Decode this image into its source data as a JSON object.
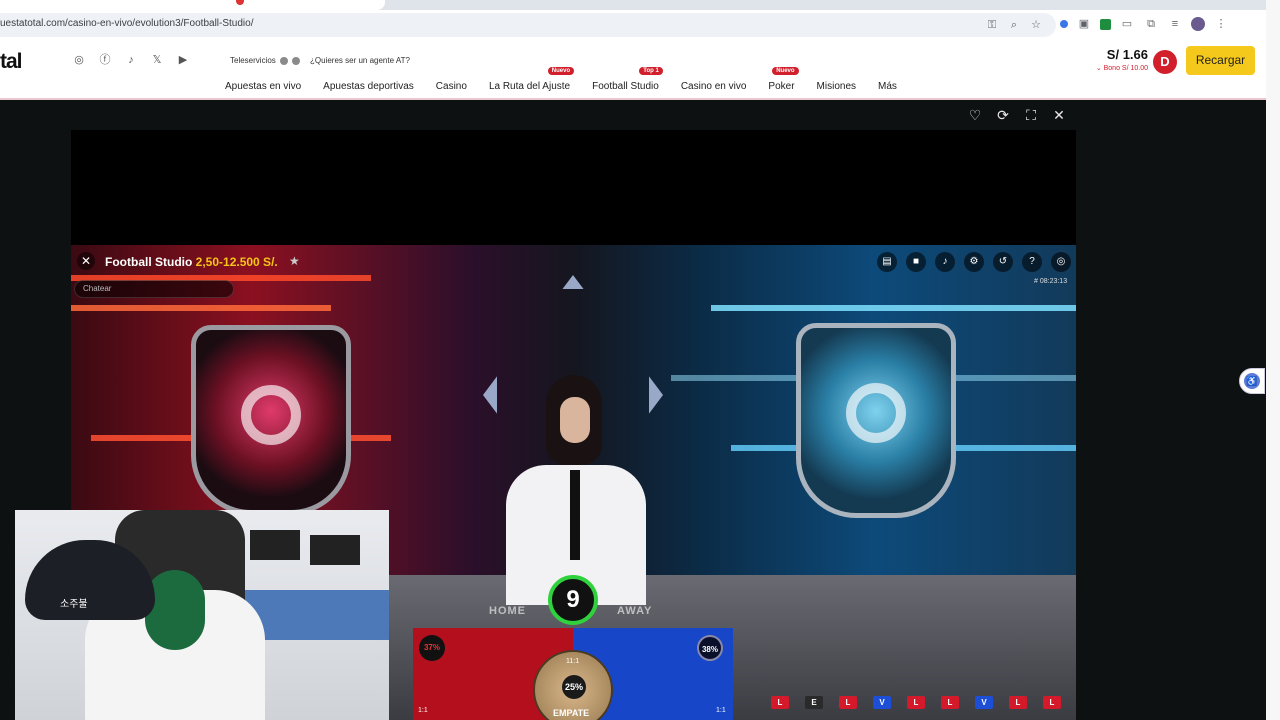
{
  "browser": {
    "url": "uestatotal.com/casino-en-vivo/evolution3/Football-Studio/"
  },
  "site": {
    "logo": "tal",
    "service_label": "Teleservicios",
    "agent_link": "¿Quieres ser un agente AT?",
    "nav": [
      {
        "label": "Apuestas en vivo",
        "badge": ""
      },
      {
        "label": "Apuestas deportivas",
        "badge": ""
      },
      {
        "label": "Casino",
        "badge": ""
      },
      {
        "label": "La Ruta del Ajuste",
        "badge": "Nuevo"
      },
      {
        "label": "Football Studio",
        "badge": "Top 1"
      },
      {
        "label": "Casino en vivo",
        "badge": ""
      },
      {
        "label": "Poker",
        "badge": "Nuevo"
      },
      {
        "label": "Misiones",
        "badge": ""
      },
      {
        "label": "Más",
        "badge": ""
      }
    ],
    "balance": "S/ 1.66",
    "bono": "Bono S/ 10.00",
    "avatar_letter": "D",
    "recharge_label": "Recargar",
    "accent_color": "#f5c91b",
    "brand_red": "#d21f2c"
  },
  "game": {
    "title": "Football Studio",
    "limits": "2,50-12.500 S/.",
    "chat_placeholder": "Chatear",
    "game_id": "# 08:23:13",
    "timer": "9",
    "home_label": "HOME",
    "away_label": "AWAY",
    "home_pct": "37%",
    "away_pct": "38%",
    "tie_pct": "25%",
    "home_odds": "1:1",
    "away_odds": "1:1",
    "tie_odds": "11:1",
    "tie_label": "EMPATE",
    "history": [
      "L",
      "E",
      "L",
      "V",
      "L",
      "L",
      "V",
      "L",
      "L"
    ]
  },
  "webcam": {
    "cap_text": "소주불"
  }
}
